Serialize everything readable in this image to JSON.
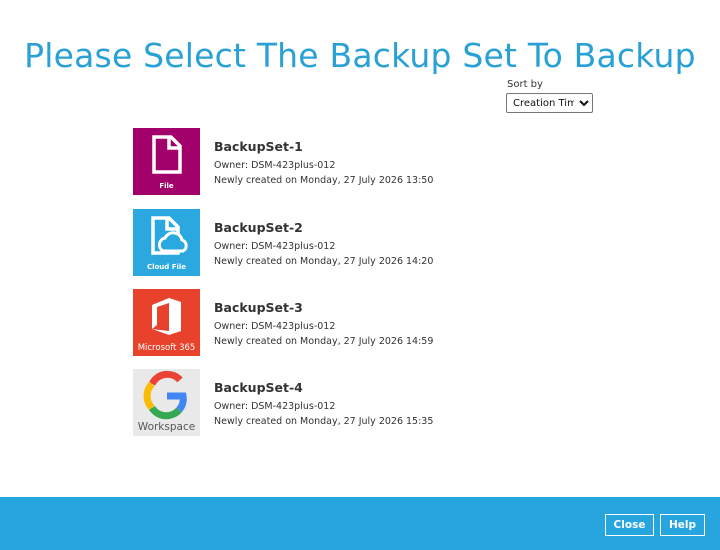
{
  "title": "Please Select The Backup Set To Backup",
  "sort": {
    "label": "Sort by",
    "selected": "Creation Time"
  },
  "backup_sets": [
    {
      "name": "BackupSet-1",
      "owner": "Owner: DSM-423plus-012",
      "created": "Newly created on Monday, 27 July 2026 13:50",
      "icon": "file-icon",
      "icon_caption": "File",
      "icon_color": "#a2006a"
    },
    {
      "name": "BackupSet-2",
      "owner": "Owner: DSM-423plus-012",
      "created": "Newly created on Monday, 27 July 2026 14:20",
      "icon": "cloud-file-icon",
      "icon_caption": "Cloud File",
      "icon_color": "#2aa8df"
    },
    {
      "name": "BackupSet-3",
      "owner": "Owner: DSM-423plus-012",
      "created": "Newly created on Monday, 27 July 2026 14:59",
      "icon": "microsoft-365-icon",
      "icon_caption": "Microsoft 365",
      "icon_color": "#e8422c"
    },
    {
      "name": "BackupSet-4",
      "owner": "Owner: DSM-423plus-012",
      "created": "Newly created on Monday, 27 July 2026 15:35",
      "icon": "google-workspace-icon",
      "icon_caption": "Workspace",
      "icon_color": "#e9e9e9"
    }
  ],
  "footer": {
    "close_label": "Close",
    "help_label": "Help",
    "color": "#27a5df"
  }
}
